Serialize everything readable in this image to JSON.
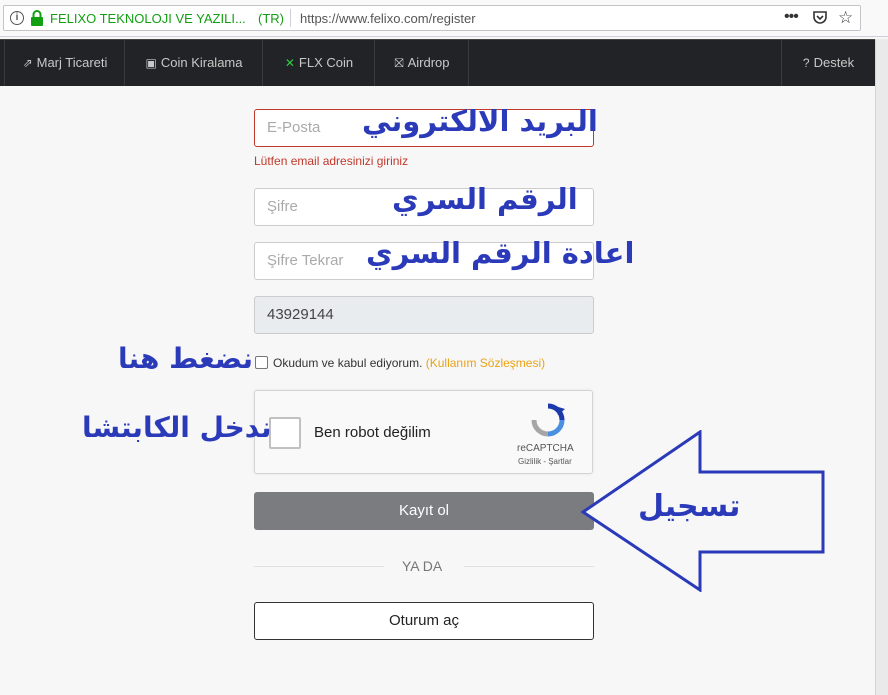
{
  "browser": {
    "site_identity": "FELIXO TEKNOLOJI VE YAZILI...",
    "country": "(TR)",
    "url": "https://www.felixo.com/register"
  },
  "nav": {
    "items": [
      {
        "icon": "chart-icon",
        "glyph": "⇗",
        "label": "Marj Ticareti"
      },
      {
        "icon": "coin-icon",
        "glyph": "▣",
        "label": "Coin Kiralama"
      },
      {
        "icon": "flx-logo-icon",
        "glyph": "✕",
        "label": "FLX Coin"
      },
      {
        "icon": "gift-icon",
        "glyph": "⛝",
        "label": "Airdrop"
      }
    ],
    "support": {
      "icon": "help-icon",
      "glyph": "?",
      "label": "Destek"
    }
  },
  "form": {
    "email_placeholder": "E-Posta",
    "email_error": "Lütfen email adresinizi giriniz",
    "password_placeholder": "Şifre",
    "password_repeat_placeholder": "Şifre Tekrar",
    "referral_value": "43929144",
    "terms_text": "Okudum ve kabul ediyorum.",
    "terms_link": "(Kullanım Sözleşmesi)",
    "captcha_label": "Ben robot değilim",
    "captcha_brand": "reCAPTCHA",
    "captcha_links": "Gizlilik - Şartlar",
    "register_button": "Kayıt ol",
    "or_text": "YA DA",
    "login_button": "Oturum aç"
  },
  "annotations": {
    "email": "البريد الالكتروني",
    "password": "الرقم السري",
    "password_repeat": "اعادة الرقم السري",
    "click_here": "نضغط هنا",
    "captcha": "ندخل الكابتشا",
    "register": "تسجيل"
  },
  "colors": {
    "annotation": "#2a3ab8",
    "error": "#c0392b",
    "link": "#e8a317",
    "nav_bg": "#222326",
    "register_bg": "#7a7c80"
  }
}
